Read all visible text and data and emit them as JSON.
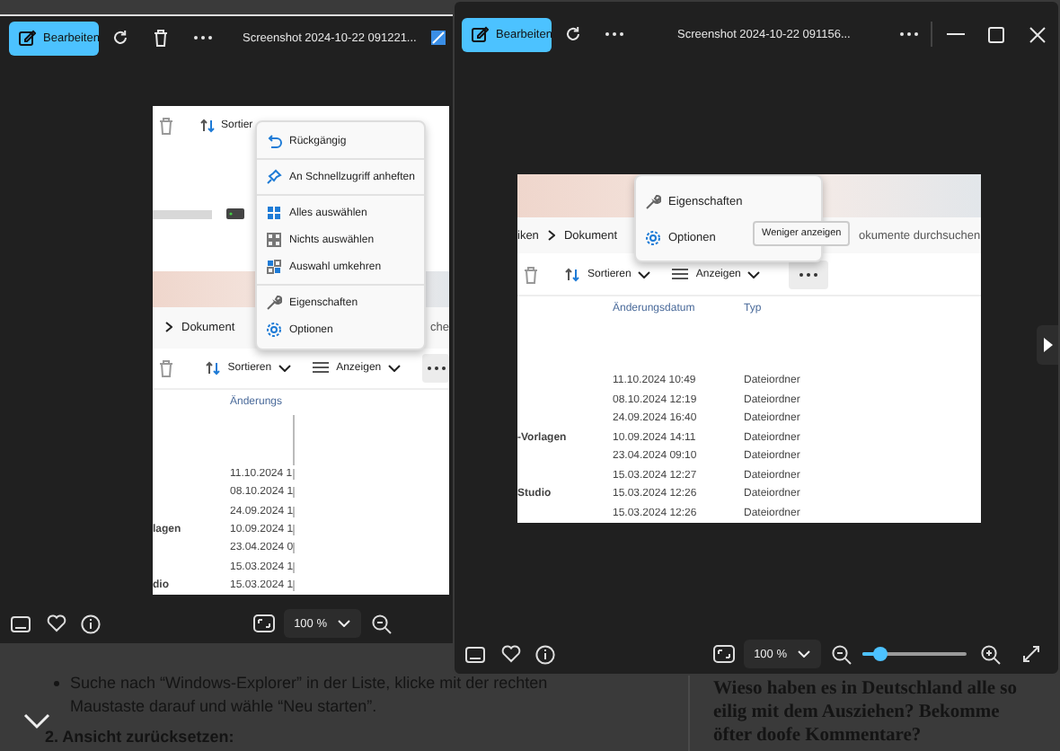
{
  "viewers": [
    {
      "edit_button": "Bearbeiten",
      "title": "Screenshot 2024-10-22 091221...",
      "window_controls": false,
      "zoom": "100 %",
      "next_button": false,
      "image": {
        "top_sort": "Sortier",
        "menu": [
          [
            {
              "kind": "undo",
              "label": "Rückgängig"
            }
          ],
          [
            {
              "kind": "pin",
              "label": "An Schnellzugriff anheften"
            }
          ],
          [
            {
              "kind": "selectall",
              "label": "Alles auswählen"
            },
            {
              "kind": "selectnone",
              "label": "Nichts auswählen"
            },
            {
              "kind": "invert",
              "label": "Auswahl umkehren"
            }
          ],
          [
            {
              "kind": "properties",
              "label": "Eigenschaften"
            },
            {
              "kind": "options",
              "label": "Optionen"
            }
          ]
        ],
        "breadcrumb": [
          "Dokument"
        ],
        "search": "che",
        "sort": "Sortieren",
        "view": "Anzeigen",
        "columns": [
          "Änderungs"
        ],
        "rows": [
          {
            "date": "11.10.2024 1"
          },
          {
            "date": "08.10.2024 1"
          },
          {
            "date": "24.09.2024 1"
          },
          {
            "name": "lagen",
            "date": "10.09.2024 1"
          },
          {
            "date": "23.04.2024 0"
          },
          {
            "date": "15.03.2024 1"
          },
          {
            "name": "dio",
            "date": "15.03.2024 1"
          }
        ]
      }
    },
    {
      "edit_button": "Bearbeiten",
      "title": "Screenshot 2024-10-22 091156...",
      "window_controls": true,
      "zoom": "100 %",
      "zoom_slider": {
        "level": 0.17
      },
      "next_button": true,
      "image": {
        "menu": [
          [
            {
              "kind": "properties",
              "label": "Eigenschaften"
            },
            {
              "kind": "options",
              "label": "Optionen"
            }
          ]
        ],
        "tooltip": "Weniger anzeigen",
        "breadcrumb": [
          "iken",
          "Dokument"
        ],
        "search": "okumente durchsuchen",
        "sort": "Sortieren",
        "view": "Anzeigen",
        "columns": [
          "Änderungsdatum",
          "Typ"
        ],
        "rows": [
          {
            "date": "11.10.2024 10:49",
            "type": "Dateiordner"
          },
          {
            "date": "08.10.2024 12:19",
            "type": "Dateiordner"
          },
          {
            "date": "24.09.2024 16:40",
            "type": "Dateiordner"
          },
          {
            "name": "-Vorlagen",
            "date": "10.09.2024 14:11",
            "type": "Dateiordner"
          },
          {
            "date": "23.04.2024 09:10",
            "type": "Dateiordner"
          },
          {
            "date": "15.03.2024 12:27",
            "type": "Dateiordner"
          },
          {
            "name": "Studio",
            "date": "15.03.2024 12:26",
            "type": "Dateiordner"
          },
          {
            "date": "15.03.2024 12:26",
            "type": "Dateiordner"
          }
        ]
      }
    }
  ],
  "article": {
    "bullet": "Suche nach “Windows-Explorer” in der Liste, klicke mit der rechten Maustaste darauf und wähle “Neu starten”.",
    "heading": "2. Ansicht zurücksetzen:",
    "aside_title": "Wieso haben es in Deutschland alle so eilig mit dem Ausziehen? Bekomme öfter doofe Kommentare?"
  }
}
